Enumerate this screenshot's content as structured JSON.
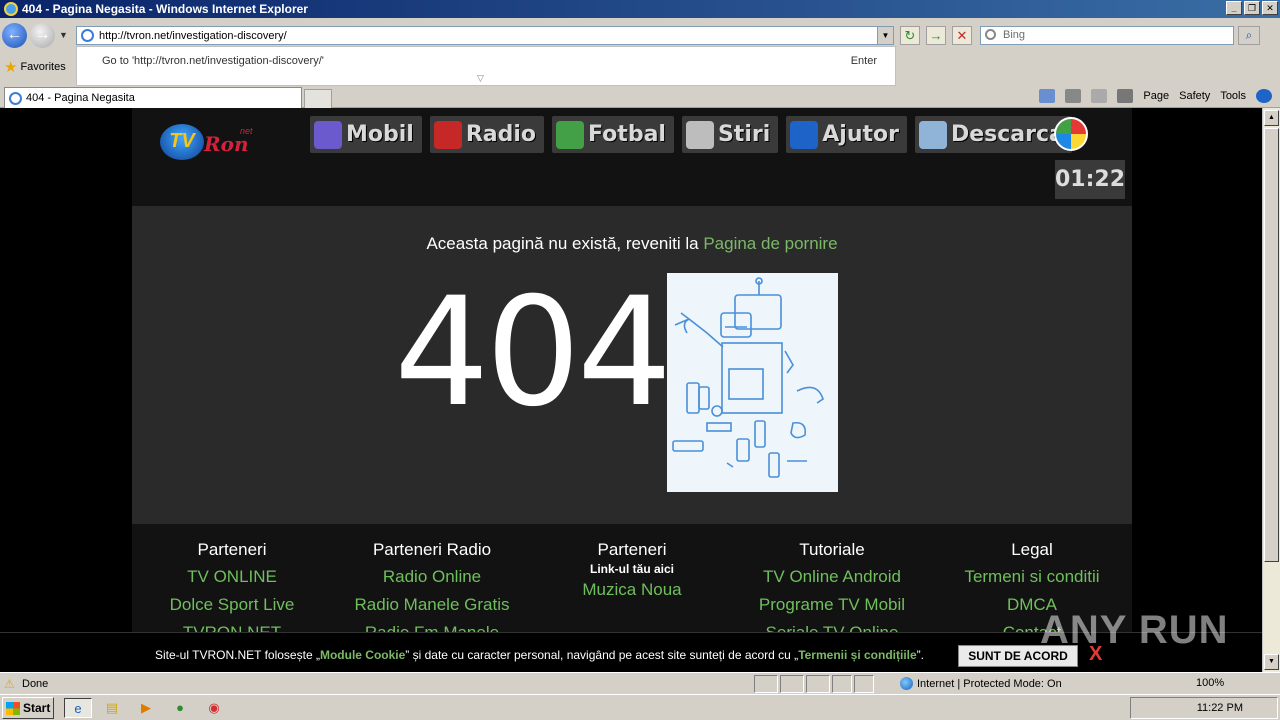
{
  "window": {
    "title": "404 - Pagina Negasita - Windows Internet Explorer",
    "min": "_",
    "max": "❐",
    "close": "✕"
  },
  "nav": {
    "address": "http://tvron.net/investigation-discovery/",
    "search_placeholder": "Bing",
    "autocomplete_goto": "Go to 'http://tvron.net/investigation-discovery/'",
    "autocomplete_enter": "Enter"
  },
  "favorites": {
    "label": "Favorites"
  },
  "tab": {
    "title": "404 - Pagina Negasita"
  },
  "cmdbar": {
    "page": "Page",
    "safety": "Safety",
    "tools": "Tools"
  },
  "site": {
    "logo_tv": "TV",
    "logo_ron": "Ron",
    "logo_net": "net",
    "menu": [
      {
        "label": "Mobil",
        "icon": "phone-icon",
        "color": "#6a5acd"
      },
      {
        "label": "Radio",
        "icon": "radio-icon",
        "color": "#c62828"
      },
      {
        "label": "Fotbal",
        "icon": "football-field-icon",
        "color": "#43a047"
      },
      {
        "label": "Stiri",
        "icon": "newspaper-icon",
        "color": "#bdbdbd"
      },
      {
        "label": "Ajutor",
        "icon": "help-icon",
        "color": "#1e64c8"
      },
      {
        "label": "Descarca",
        "icon": "download-icon",
        "color": "#8fb4d8"
      }
    ],
    "clock": "01:22",
    "message_text": "Aceasta pagină nu există, reveniti la ",
    "message_link": "Pagina de pornire",
    "error_code": "404",
    "footer": [
      {
        "title": "Parteneri",
        "sub": "",
        "links": [
          "TV ONLINE",
          "Dolce Sport Live",
          "TVRON.NET"
        ]
      },
      {
        "title": "Parteneri Radio",
        "sub": "",
        "links": [
          "Radio Online",
          "Radio Manele Gratis",
          "Radio Fm Manele"
        ]
      },
      {
        "title": "Parteneri",
        "sub": "Link-ul tău aici",
        "links": [
          "Muzica Noua"
        ]
      },
      {
        "title": "Tutoriale",
        "sub": "",
        "links": [
          "TV Online Android",
          "Programe TV Mobil",
          "Seriale TV Online"
        ]
      },
      {
        "title": "Legal",
        "sub": "",
        "links": [
          "Termeni si conditii",
          "DMCA",
          "Contact"
        ]
      }
    ],
    "cookie_text_1": "Site-ul TVRON.NET folosește „",
    "cookie_bold_1": "Module Cookie",
    "cookie_text_2": "” și date cu caracter personal, navigând pe acest site sunteți de acord cu „",
    "cookie_bold_2": "Termenii și condițiile",
    "cookie_text_3": "”.",
    "cookie_accept": "SUNT DE ACORD",
    "cookie_close": "X"
  },
  "watermark": "ANY RUN",
  "status": {
    "text": "Done",
    "zone": "Internet | Protected Mode: On",
    "zoom": "100%"
  },
  "taskbar": {
    "start": "Start",
    "clock": "11:22 PM"
  }
}
